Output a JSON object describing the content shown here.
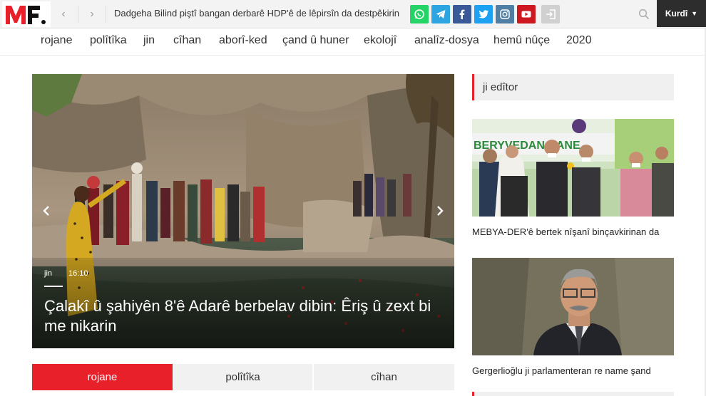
{
  "topbar": {
    "ticker_text": "Dadgeha Bilind piştî bangan derbarê HDP'ê de lêpirsîn da destpêkirin -",
    "language": "Kurdî",
    "social": [
      "whatsapp-icon",
      "telegram-icon",
      "facebook-icon",
      "twitter-icon",
      "instagram-icon",
      "youtube-icon",
      "login-icon"
    ]
  },
  "nav": {
    "items": [
      "rojane",
      "polîtîka",
      "jin",
      "cîhan",
      "aborî-ked",
      "çand û huner",
      "ekolojî",
      "analîz-dosya",
      "hemû nûçe",
      "2020"
    ]
  },
  "slider": {
    "category": "jin",
    "time": "16:10",
    "title": "Çalakî û şahiyên 8'ê Adarê berbelav dibin: Êriş û zext bi me nikarin"
  },
  "tabs": [
    {
      "label": "rojane",
      "active": true
    },
    {
      "label": "polîtîka",
      "active": false
    },
    {
      "label": "cîhan",
      "active": false
    }
  ],
  "sidebar": {
    "heading": "ji edîtor",
    "banner_text": "BERYVEDAN HANE",
    "items": [
      {
        "caption": "MEBYA-DER'ê bertek nîşanî binçavkirinan da"
      },
      {
        "caption": "Gergerlioğlu ji parlamenteran re name şand"
      }
    ]
  },
  "colors": {
    "accent": "#e8202a",
    "topbar_bg": "#f3f3f3",
    "lang_bg": "#2d2d2d"
  }
}
